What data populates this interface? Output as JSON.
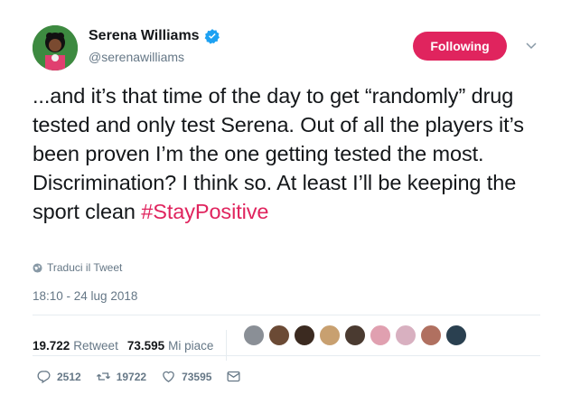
{
  "user": {
    "name": "Serena Williams",
    "handle": "@serenawilliams",
    "verified_icon": "verified-badge-icon",
    "verified_color": "#1da1f2"
  },
  "follow_button": {
    "label": "Following",
    "color": "#e0245e"
  },
  "tweet": {
    "text": "...and it’s that time of the day to get “randomly” drug tested and only test Serena. Out of all the players it’s been proven I’m the one getting tested the most. Discrimination? I think so. At least I’ll be keeping the sport clean ",
    "hashtag": "#StayPositive",
    "hashtag_color": "#e0245e"
  },
  "translate_label": "Traduci il Tweet",
  "timestamp": "18:10 - 24 lug 2018",
  "stats": {
    "retweets_count": "19.722",
    "retweets_label": "Retweet",
    "likes_count": "73.595",
    "likes_label": "Mi piace"
  },
  "likers": [
    "#8a8f96",
    "#6b4a35",
    "#3b2a20",
    "#c8a070",
    "#4a3a30",
    "#e0a0b0",
    "#d8b0c0",
    "#b07060",
    "#2a4050"
  ],
  "actions": {
    "reply_count": "2512",
    "retweet_count": "19722",
    "like_count": "73595"
  }
}
